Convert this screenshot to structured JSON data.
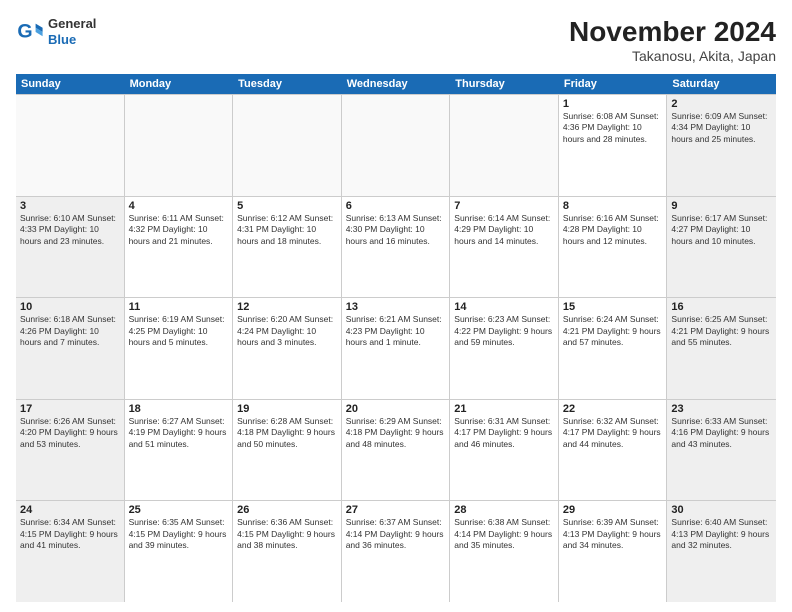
{
  "header": {
    "logo_line1": "General",
    "logo_line2": "Blue",
    "title": "November 2024",
    "subtitle": "Takanosu, Akita, Japan"
  },
  "calendar": {
    "days_of_week": [
      "Sunday",
      "Monday",
      "Tuesday",
      "Wednesday",
      "Thursday",
      "Friday",
      "Saturday"
    ],
    "weeks": [
      [
        {
          "day": "",
          "info": "",
          "empty": true
        },
        {
          "day": "",
          "info": "",
          "empty": true
        },
        {
          "day": "",
          "info": "",
          "empty": true
        },
        {
          "day": "",
          "info": "",
          "empty": true
        },
        {
          "day": "",
          "info": "",
          "empty": true
        },
        {
          "day": "1",
          "info": "Sunrise: 6:08 AM\nSunset: 4:36 PM\nDaylight: 10 hours and 28 minutes."
        },
        {
          "day": "2",
          "info": "Sunrise: 6:09 AM\nSunset: 4:34 PM\nDaylight: 10 hours and 25 minutes.",
          "shaded": true
        }
      ],
      [
        {
          "day": "3",
          "info": "Sunrise: 6:10 AM\nSunset: 4:33 PM\nDaylight: 10 hours and 23 minutes.",
          "shaded": true
        },
        {
          "day": "4",
          "info": "Sunrise: 6:11 AM\nSunset: 4:32 PM\nDaylight: 10 hours and 21 minutes."
        },
        {
          "day": "5",
          "info": "Sunrise: 6:12 AM\nSunset: 4:31 PM\nDaylight: 10 hours and 18 minutes."
        },
        {
          "day": "6",
          "info": "Sunrise: 6:13 AM\nSunset: 4:30 PM\nDaylight: 10 hours and 16 minutes."
        },
        {
          "day": "7",
          "info": "Sunrise: 6:14 AM\nSunset: 4:29 PM\nDaylight: 10 hours and 14 minutes."
        },
        {
          "day": "8",
          "info": "Sunrise: 6:16 AM\nSunset: 4:28 PM\nDaylight: 10 hours and 12 minutes."
        },
        {
          "day": "9",
          "info": "Sunrise: 6:17 AM\nSunset: 4:27 PM\nDaylight: 10 hours and 10 minutes.",
          "shaded": true
        }
      ],
      [
        {
          "day": "10",
          "info": "Sunrise: 6:18 AM\nSunset: 4:26 PM\nDaylight: 10 hours and 7 minutes.",
          "shaded": true
        },
        {
          "day": "11",
          "info": "Sunrise: 6:19 AM\nSunset: 4:25 PM\nDaylight: 10 hours and 5 minutes."
        },
        {
          "day": "12",
          "info": "Sunrise: 6:20 AM\nSunset: 4:24 PM\nDaylight: 10 hours and 3 minutes."
        },
        {
          "day": "13",
          "info": "Sunrise: 6:21 AM\nSunset: 4:23 PM\nDaylight: 10 hours and 1 minute."
        },
        {
          "day": "14",
          "info": "Sunrise: 6:23 AM\nSunset: 4:22 PM\nDaylight: 9 hours and 59 minutes."
        },
        {
          "day": "15",
          "info": "Sunrise: 6:24 AM\nSunset: 4:21 PM\nDaylight: 9 hours and 57 minutes."
        },
        {
          "day": "16",
          "info": "Sunrise: 6:25 AM\nSunset: 4:21 PM\nDaylight: 9 hours and 55 minutes.",
          "shaded": true
        }
      ],
      [
        {
          "day": "17",
          "info": "Sunrise: 6:26 AM\nSunset: 4:20 PM\nDaylight: 9 hours and 53 minutes.",
          "shaded": true
        },
        {
          "day": "18",
          "info": "Sunrise: 6:27 AM\nSunset: 4:19 PM\nDaylight: 9 hours and 51 minutes."
        },
        {
          "day": "19",
          "info": "Sunrise: 6:28 AM\nSunset: 4:18 PM\nDaylight: 9 hours and 50 minutes."
        },
        {
          "day": "20",
          "info": "Sunrise: 6:29 AM\nSunset: 4:18 PM\nDaylight: 9 hours and 48 minutes."
        },
        {
          "day": "21",
          "info": "Sunrise: 6:31 AM\nSunset: 4:17 PM\nDaylight: 9 hours and 46 minutes."
        },
        {
          "day": "22",
          "info": "Sunrise: 6:32 AM\nSunset: 4:17 PM\nDaylight: 9 hours and 44 minutes."
        },
        {
          "day": "23",
          "info": "Sunrise: 6:33 AM\nSunset: 4:16 PM\nDaylight: 9 hours and 43 minutes.",
          "shaded": true
        }
      ],
      [
        {
          "day": "24",
          "info": "Sunrise: 6:34 AM\nSunset: 4:15 PM\nDaylight: 9 hours and 41 minutes.",
          "shaded": true
        },
        {
          "day": "25",
          "info": "Sunrise: 6:35 AM\nSunset: 4:15 PM\nDaylight: 9 hours and 39 minutes."
        },
        {
          "day": "26",
          "info": "Sunrise: 6:36 AM\nSunset: 4:15 PM\nDaylight: 9 hours and 38 minutes."
        },
        {
          "day": "27",
          "info": "Sunrise: 6:37 AM\nSunset: 4:14 PM\nDaylight: 9 hours and 36 minutes."
        },
        {
          "day": "28",
          "info": "Sunrise: 6:38 AM\nSunset: 4:14 PM\nDaylight: 9 hours and 35 minutes."
        },
        {
          "day": "29",
          "info": "Sunrise: 6:39 AM\nSunset: 4:13 PM\nDaylight: 9 hours and 34 minutes."
        },
        {
          "day": "30",
          "info": "Sunrise: 6:40 AM\nSunset: 4:13 PM\nDaylight: 9 hours and 32 minutes.",
          "shaded": true
        }
      ]
    ]
  }
}
